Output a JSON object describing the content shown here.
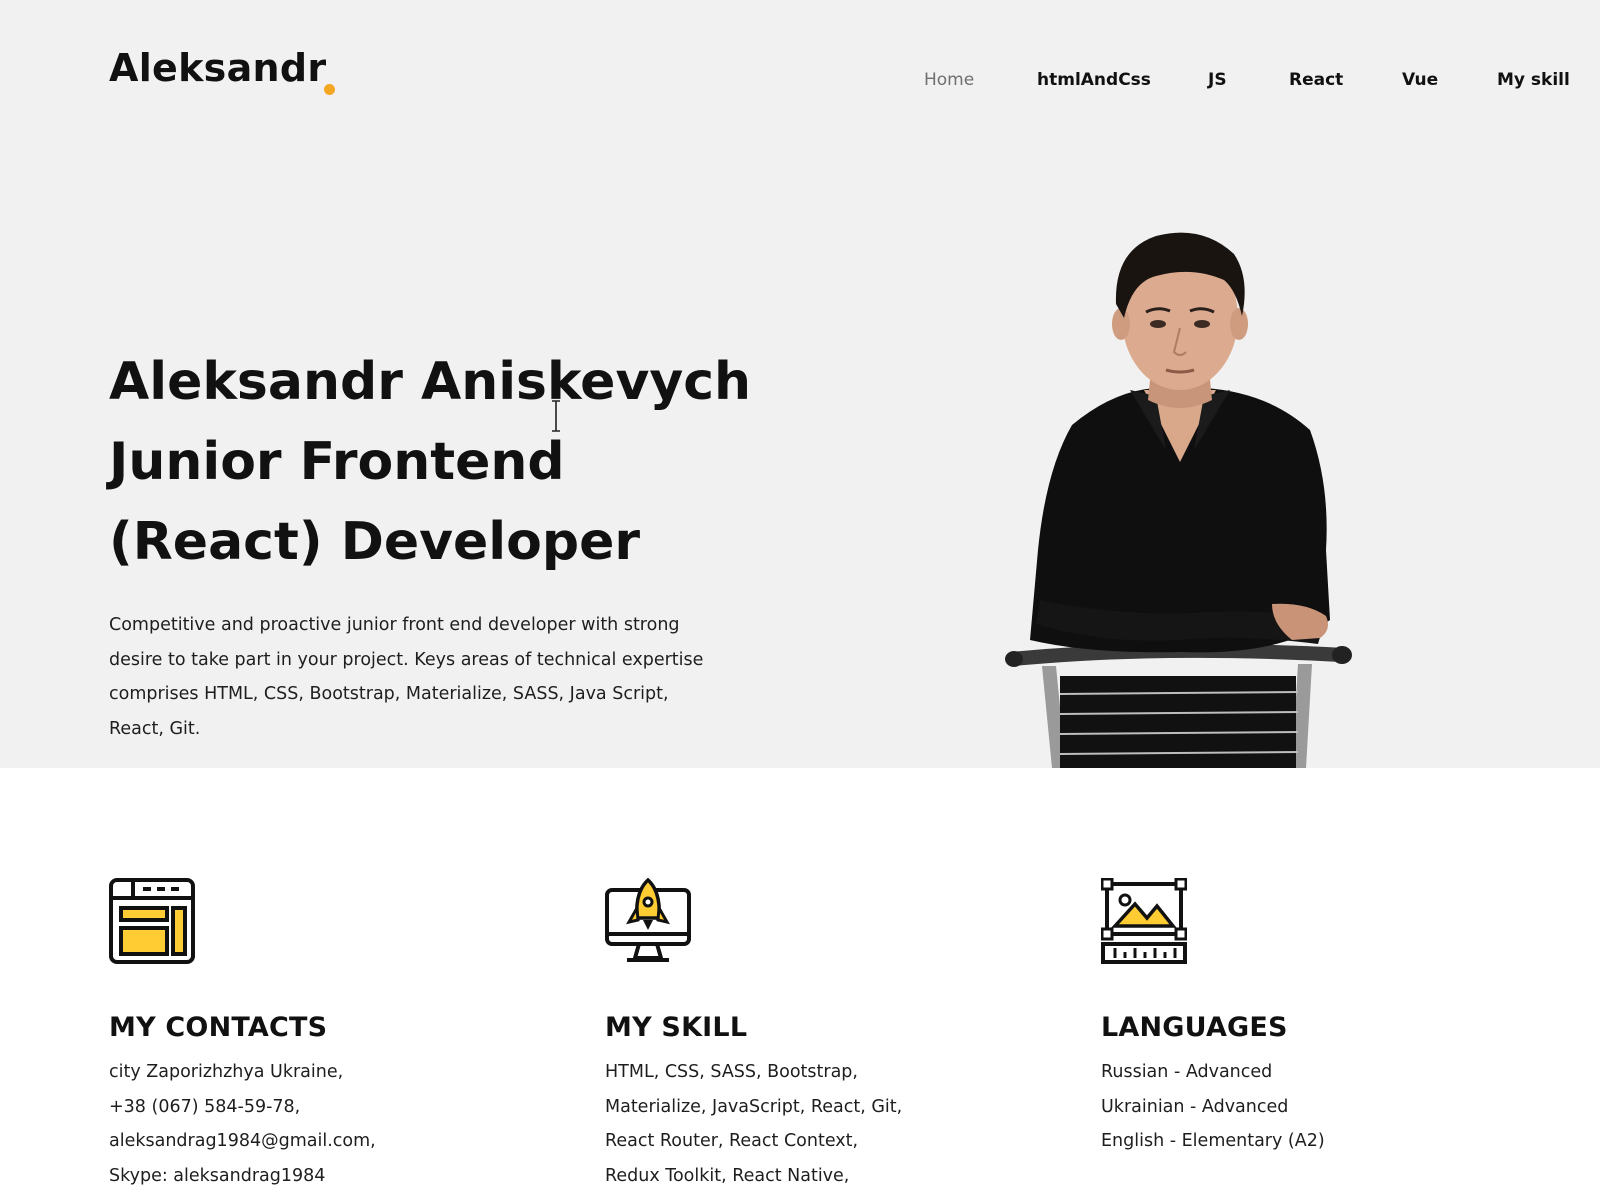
{
  "header": {
    "logo_text": "Aleksandr",
    "accent_color": "#f5a623",
    "nav": [
      {
        "label": "Home",
        "active": true
      },
      {
        "label": "htmlAndCss",
        "active": false
      },
      {
        "label": "JS",
        "active": false
      },
      {
        "label": "React",
        "active": false
      },
      {
        "label": "Vue",
        "active": false
      },
      {
        "label": "My skill",
        "active": false
      }
    ]
  },
  "hero": {
    "title_lines": [
      "Aleksandr Aniskevych",
      "Junior Frontend",
      "(React) Developer"
    ],
    "description": "Competitive and proactive junior front end developer with strong desire to take part in your project. Keys areas of technical expertise comprises HTML, CSS, Bootstrap, Materialize, SASS, Java Script, React, Git.",
    "photo_icon": "portrait-photo"
  },
  "features": [
    {
      "icon": "browser-layout-icon",
      "title": "MY CONTACTS",
      "lines": [
        "city Zaporizhzhya Ukraine,",
        "+38 (067) 584-59-78,",
        "aleksandrag1984@gmail.com,",
        "Skype: aleksandrag1984"
      ]
    },
    {
      "icon": "rocket-monitor-icon",
      "title": "MY SKILL",
      "lines": [
        "HTML, CSS, SASS, Bootstrap,",
        "Materialize, JavaScript, React, Git,",
        "React Router, React Context,",
        "Redux Toolkit, React Native,"
      ]
    },
    {
      "icon": "image-ruler-icon",
      "title": "LANGUAGES",
      "lines": [
        "Russian - Advanced",
        "Ukrainian - Advanced",
        "English - Elementary (A2)"
      ]
    }
  ]
}
